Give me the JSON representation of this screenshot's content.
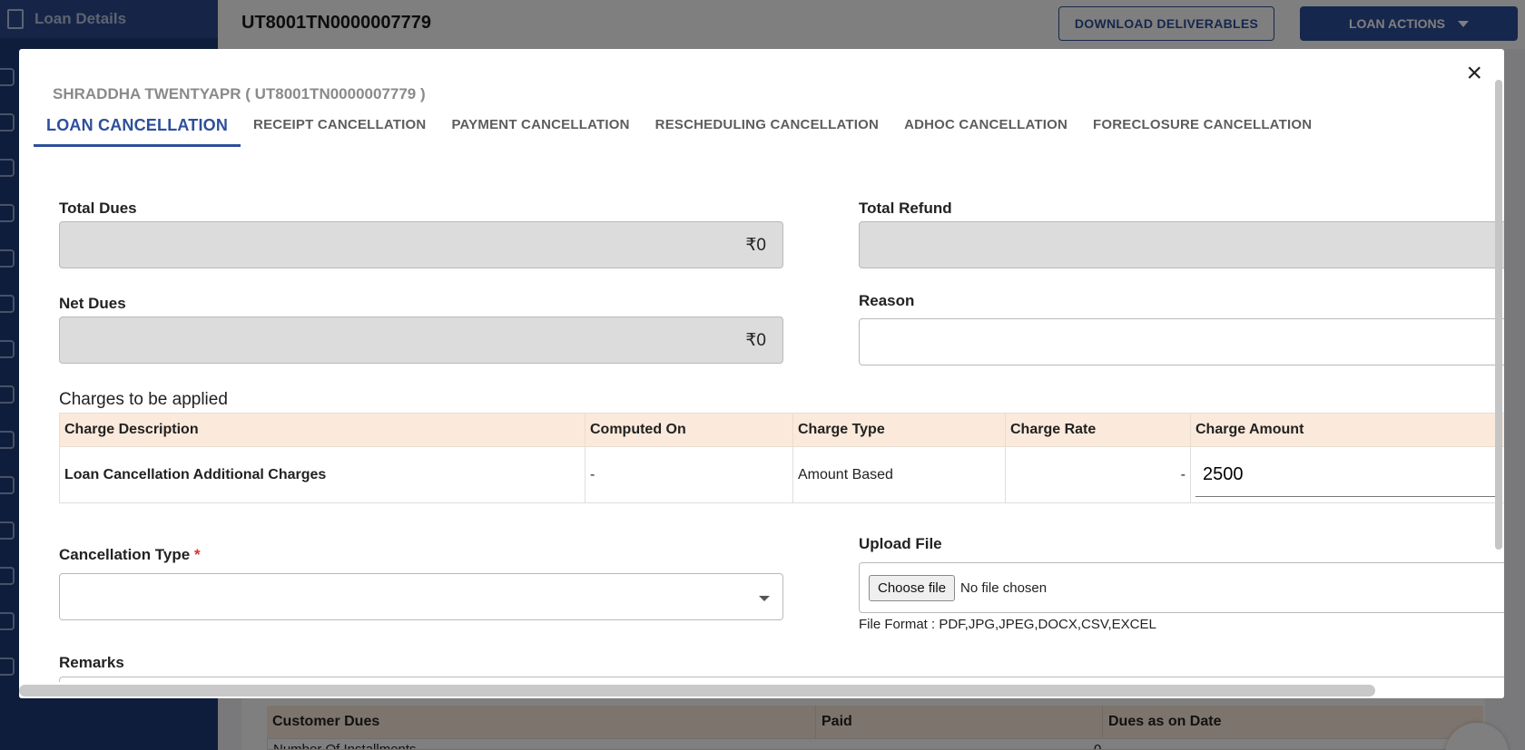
{
  "sidebar": {
    "header_label": "Loan Details"
  },
  "header": {
    "loan_id": "UT8001TN0000007779",
    "download_label": "DOWNLOAD DELIVERABLES",
    "loan_actions_label": "LOAN ACTIONS"
  },
  "background": {
    "table_headers": [
      "Customer Dues",
      "Paid",
      "Dues as on Date"
    ],
    "row_label": "Number Of Installments",
    "row_value": "0"
  },
  "modal": {
    "close_label": "×",
    "borrower_line": "SHRADDHA TWENTYAPR ( UT8001TN0000007779 )",
    "tabs": [
      "LOAN CANCELLATION",
      "RECEIPT CANCELLATION",
      "PAYMENT CANCELLATION",
      "RESCHEDULING CANCELLATION",
      "ADHOC CANCELLATION",
      "FORECLOSURE CANCELLATION"
    ],
    "total_dues": {
      "label": "Total Dues",
      "value": "₹0"
    },
    "net_dues": {
      "label": "Net Dues",
      "value": "₹0"
    },
    "total_refund": {
      "label": "Total Refund",
      "value": ""
    },
    "reason": {
      "label": "Reason",
      "value": ""
    },
    "charges": {
      "title": "Charges to be applied",
      "headers": [
        "Charge Description",
        "Computed On",
        "Charge Type",
        "Charge Rate",
        "Charge Amount"
      ],
      "rows": [
        {
          "description": "Loan Cancellation Additional Charges",
          "computed_on": "-",
          "charge_type": "Amount Based",
          "charge_rate": "-",
          "charge_amount": "2500"
        }
      ]
    },
    "cancellation_type": {
      "label": "Cancellation Type",
      "required_mark": "*",
      "value": ""
    },
    "upload": {
      "label": "Upload File",
      "button_label": "Choose file",
      "status": "No file chosen",
      "format_note": "File Format : PDF,JPG,JPEG,DOCX,CSV,EXCEL"
    },
    "remarks": {
      "label": "Remarks",
      "value": ""
    }
  }
}
